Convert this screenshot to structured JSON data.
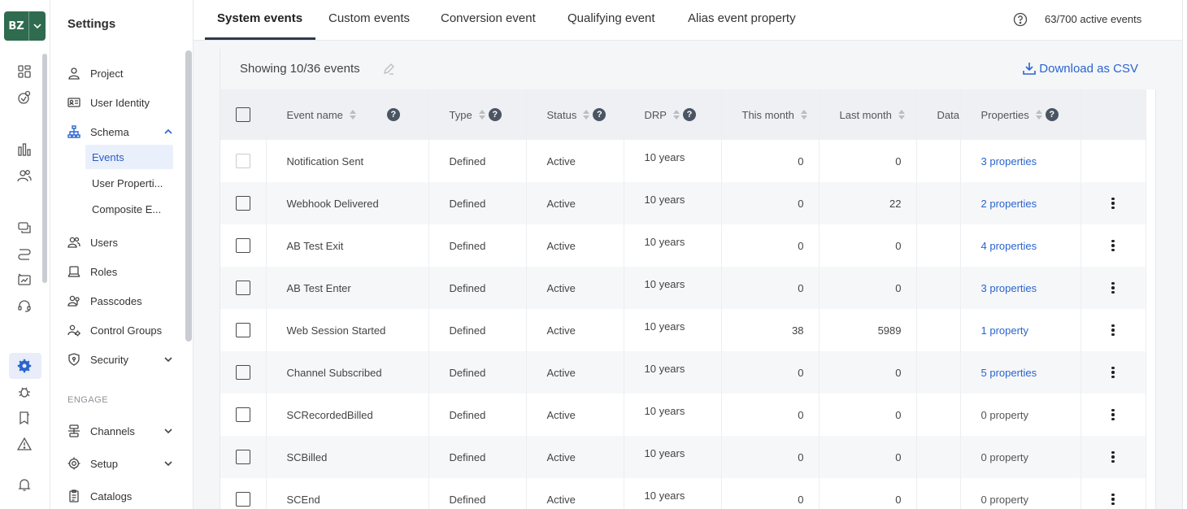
{
  "workspace": {
    "abbr": "BZ"
  },
  "sidebar": {
    "title": "Settings",
    "items": [
      {
        "label": "Project",
        "icon": "person-icon"
      },
      {
        "label": "User Identity",
        "icon": "id-card-icon"
      },
      {
        "label": "Schema",
        "icon": "schema-icon"
      },
      {
        "label": "Users",
        "icon": "users-icon"
      },
      {
        "label": "Roles",
        "icon": "roles-icon"
      },
      {
        "label": "Passcodes",
        "icon": "passcode-icon"
      },
      {
        "label": "Control Groups",
        "icon": "control-groups-icon"
      },
      {
        "label": "Security",
        "icon": "shield-icon"
      }
    ],
    "schema_sub": [
      "Events",
      "User Properti...",
      "Composite E..."
    ],
    "section_engage": "ENGAGE",
    "engage_items": [
      {
        "label": "Channels",
        "icon": "channels-icon"
      },
      {
        "label": "Setup",
        "icon": "gear-icon"
      },
      {
        "label": "Catalogs",
        "icon": "catalog-icon"
      }
    ]
  },
  "tabs": [
    "System events",
    "Custom events",
    "Conversion event",
    "Qualifying event",
    "Alias event property"
  ],
  "active_events": "63/700 active events",
  "toolbar": {
    "showing": "Showing 10/36 events",
    "download": "Download as CSV"
  },
  "table": {
    "headers": [
      "Event name",
      "Type",
      "Status",
      "DRP",
      "This month",
      "Last month",
      "Data",
      "Properties"
    ],
    "rows": [
      {
        "name": "Notification Sent",
        "type": "Defined",
        "status": "Active",
        "drp": "10 years",
        "this_month": "0",
        "last_month": "0",
        "properties": "3 properties"
      },
      {
        "name": "Webhook Delivered",
        "type": "Defined",
        "status": "Active",
        "drp": "10 years",
        "this_month": "0",
        "last_month": "22",
        "properties": "2 properties"
      },
      {
        "name": "AB Test Exit",
        "type": "Defined",
        "status": "Active",
        "drp": "10 years",
        "this_month": "0",
        "last_month": "0",
        "properties": "4 properties"
      },
      {
        "name": "AB Test Enter",
        "type": "Defined",
        "status": "Active",
        "drp": "10 years",
        "this_month": "0",
        "last_month": "0",
        "properties": "3 properties"
      },
      {
        "name": "Web Session Started",
        "type": "Defined",
        "status": "Active",
        "drp": "10 years",
        "this_month": "38",
        "last_month": "5989",
        "properties": "1 property"
      },
      {
        "name": "Channel Subscribed",
        "type": "Defined",
        "status": "Active",
        "drp": "10 years",
        "this_month": "0",
        "last_month": "0",
        "properties": "5 properties"
      },
      {
        "name": "SCRecordedBilled",
        "type": "Defined",
        "status": "Active",
        "drp": "10 years",
        "this_month": "0",
        "last_month": "0",
        "properties": "0 property"
      },
      {
        "name": "SCBilled",
        "type": "Defined",
        "status": "Active",
        "drp": "10 years",
        "this_month": "0",
        "last_month": "0",
        "properties": "0 property"
      },
      {
        "name": "SCEnd",
        "type": "Defined",
        "status": "Active",
        "drp": "10 years",
        "this_month": "0",
        "last_month": "0",
        "properties": "0 property"
      }
    ]
  },
  "colors": {
    "brand": "#2f6b4f",
    "link": "#2a64d0",
    "active_bg": "#eaf0fb"
  }
}
